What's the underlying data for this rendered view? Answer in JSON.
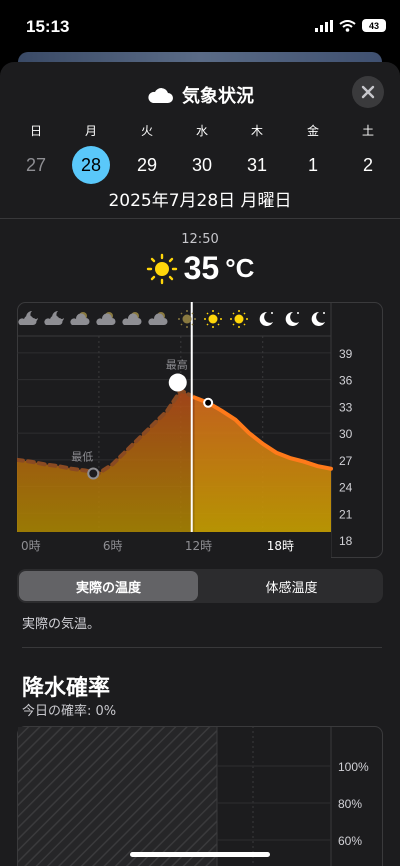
{
  "status": {
    "time": "15:13",
    "battery": "43"
  },
  "header": {
    "title": "気象状況",
    "icon": "cloud-icon",
    "close": "close-icon"
  },
  "week": [
    {
      "dow": "日",
      "day": "27",
      "state": "past"
    },
    {
      "dow": "月",
      "day": "28",
      "state": "selected"
    },
    {
      "dow": "火",
      "day": "29",
      "state": "future"
    },
    {
      "dow": "水",
      "day": "30",
      "state": "future"
    },
    {
      "dow": "木",
      "day": "31",
      "state": "future"
    },
    {
      "dow": "金",
      "day": "1",
      "state": "future"
    },
    {
      "dow": "土",
      "day": "2",
      "state": "future"
    }
  ],
  "date_line": "2025年7月28日 月曜日",
  "current": {
    "time": "12:50",
    "temp": "35",
    "unit": "°C",
    "icon": "sun-icon"
  },
  "chart_data": {
    "type": "area",
    "x": [
      0,
      1,
      2,
      3,
      4,
      5,
      6,
      7,
      8,
      9,
      10,
      11,
      12,
      13,
      14,
      15,
      16,
      17,
      18,
      19,
      20,
      21,
      22,
      23
    ],
    "series": [
      {
        "values": [
          27,
          26.8,
          26.5,
          26.3,
          26,
          25.8,
          25.5,
          26.5,
          28,
          29.5,
          31,
          32.5,
          34.8,
          34,
          33.4,
          32.5,
          31.5,
          30,
          28.8,
          27.8,
          27.2,
          26.8,
          26.3,
          26
        ]
      }
    ],
    "xticks": [
      "0時",
      "6時",
      "12時",
      "18時"
    ],
    "yticks": [
      "39",
      "36",
      "33",
      "30",
      "27",
      "24",
      "21",
      "18"
    ],
    "ylim": [
      18,
      40
    ],
    "annotations": [
      {
        "label": "最低",
        "x": 5,
        "y": 25.8
      },
      {
        "label": "最高",
        "x": 12.8,
        "y": 35
      }
    ],
    "hour_icons": [
      "moon-cloud-icon",
      "moon-cloud-icon",
      "sun-cloud-icon",
      "sun-cloud-icon",
      "sun-cloud-icon",
      "sun-cloud-icon",
      "sun-icon",
      "sun-icon",
      "sun-icon",
      "moon-icon",
      "moon-icon",
      "moon-icon"
    ],
    "current_hour": 12.8
  },
  "toggle": {
    "active": "実際の温度",
    "inactive": "体感温度"
  },
  "description": "実際の気温。",
  "precip": {
    "title": "降水確率",
    "subtitle": "今日の確率: 0%",
    "yticks": [
      "100%",
      "80%",
      "60%"
    ]
  }
}
